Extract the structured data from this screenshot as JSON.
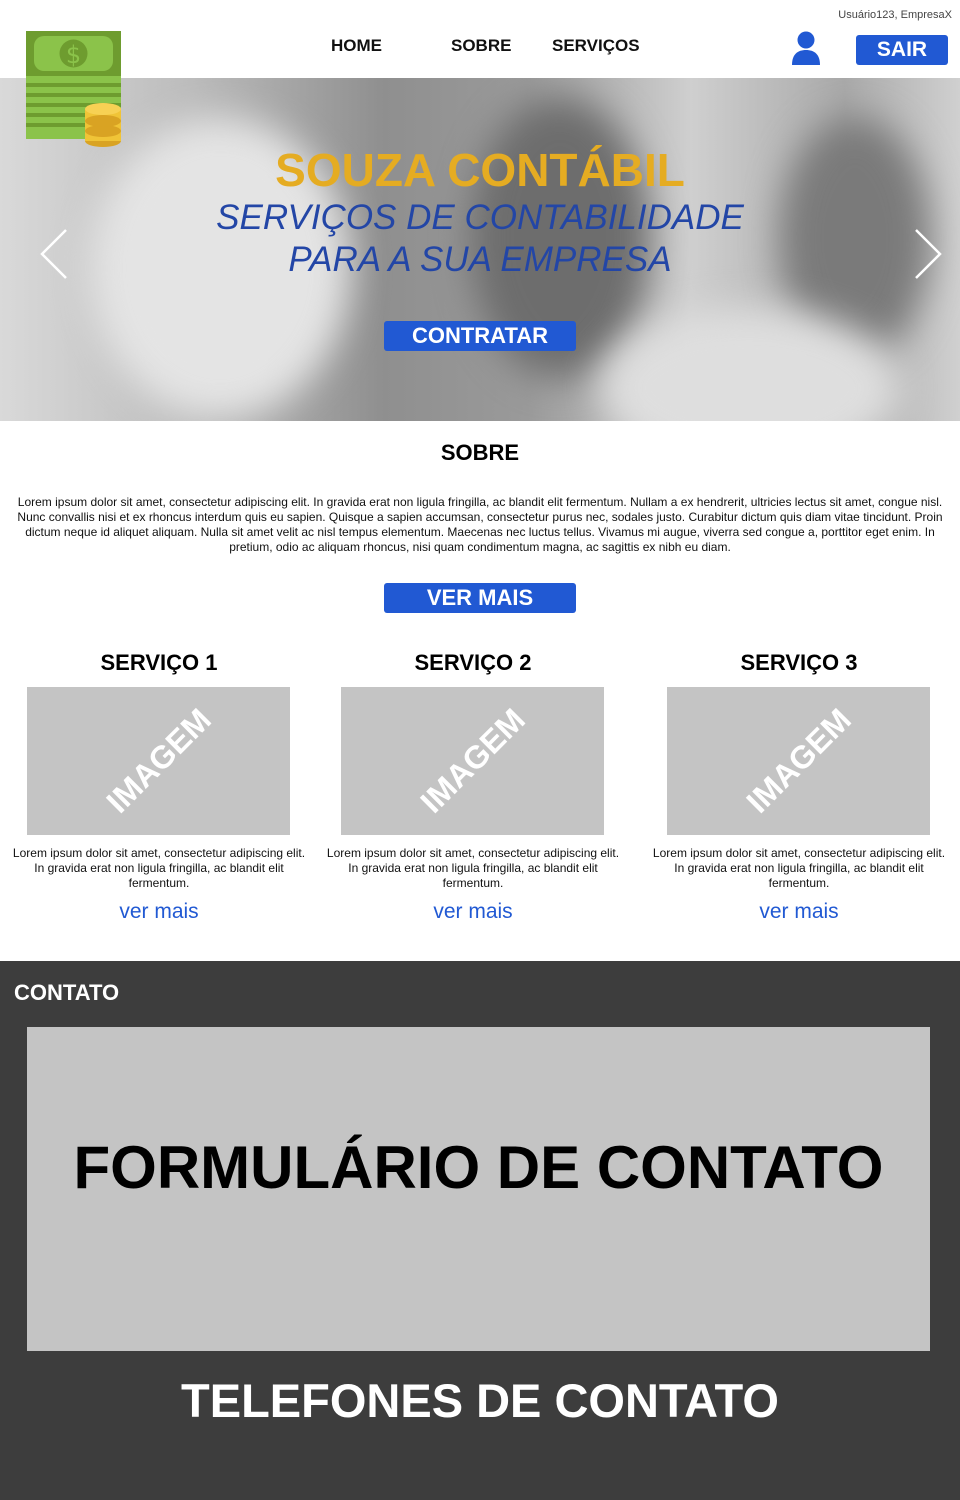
{
  "header": {
    "user_info": "Usuário123, EmpresaX",
    "nav": {
      "home": "HOME",
      "sobre": "SOBRE",
      "servicos": "SERVIÇOS"
    },
    "logout_label": "SAIR"
  },
  "hero": {
    "title": "SOUZA CONTÁBIL",
    "subtitle_line1": "SERVIÇOS DE CONTABILIDADE",
    "subtitle_line2": "PARA A SUA EMPRESA",
    "cta_label": "CONTRATAR"
  },
  "sobre": {
    "title": "SOBRE",
    "text": "Lorem ipsum dolor sit amet, consectetur adipiscing elit. In gravida erat non ligula fringilla, ac blandit elit fermentum. Nullam a ex hendrerit, ultricies lectus sit amet, congue nisl. Nunc convallis nisi et ex rhoncus interdum quis eu sapien. Quisque a sapien accumsan, consectetur purus nec, sodales justo. Curabitur dictum quis diam vitae tincidunt. Proin dictum neque id aliquet aliquam. Nulla sit amet velit ac nisl tempus elementum. Maecenas nec luctus tellus. Vivamus mi augue, viverra sed congue a, porttitor eget enim. In pretium, odio ac aliquam rhoncus, nisi quam condimentum magna, ac sagittis ex nibh eu diam.",
    "button_label": "VER MAIS"
  },
  "services": [
    {
      "title": "SERVIÇO 1",
      "image_label": "IMAGEM",
      "text": "Lorem ipsum dolor sit amet, consectetur adipiscing elit. In gravida erat non ligula fringilla, ac blandit elit fermentum.",
      "link": "ver mais"
    },
    {
      "title": "SERVIÇO 2",
      "image_label": "IMAGEM",
      "text": "Lorem ipsum dolor sit amet, consectetur adipiscing elit. In gravida erat non ligula fringilla, ac blandit elit fermentum.",
      "link": "ver mais"
    },
    {
      "title": "SERVIÇO 3",
      "image_label": "IMAGEM",
      "text": "Lorem ipsum dolor sit amet, consectetur adipiscing elit. In gravida erat non ligula fringilla, ac blandit elit fermentum.",
      "link": "ver mais"
    }
  ],
  "contato": {
    "title": "CONTATO",
    "form_label": "FORMULÁRIO DE CONTATO",
    "phones_label": "TELEFONES DE CONTATO"
  },
  "icons": {
    "logo": "money-stack-coins-icon",
    "user": "user-icon",
    "prev": "chevron-left-icon",
    "next": "chevron-right-icon"
  },
  "colors": {
    "accent_blue": "#2159d3",
    "title_gold": "#e5ac22",
    "subtitle_blue": "#2346a6",
    "footer_bg": "#3d3d3d",
    "placeholder_gray": "#c4c4c4"
  }
}
